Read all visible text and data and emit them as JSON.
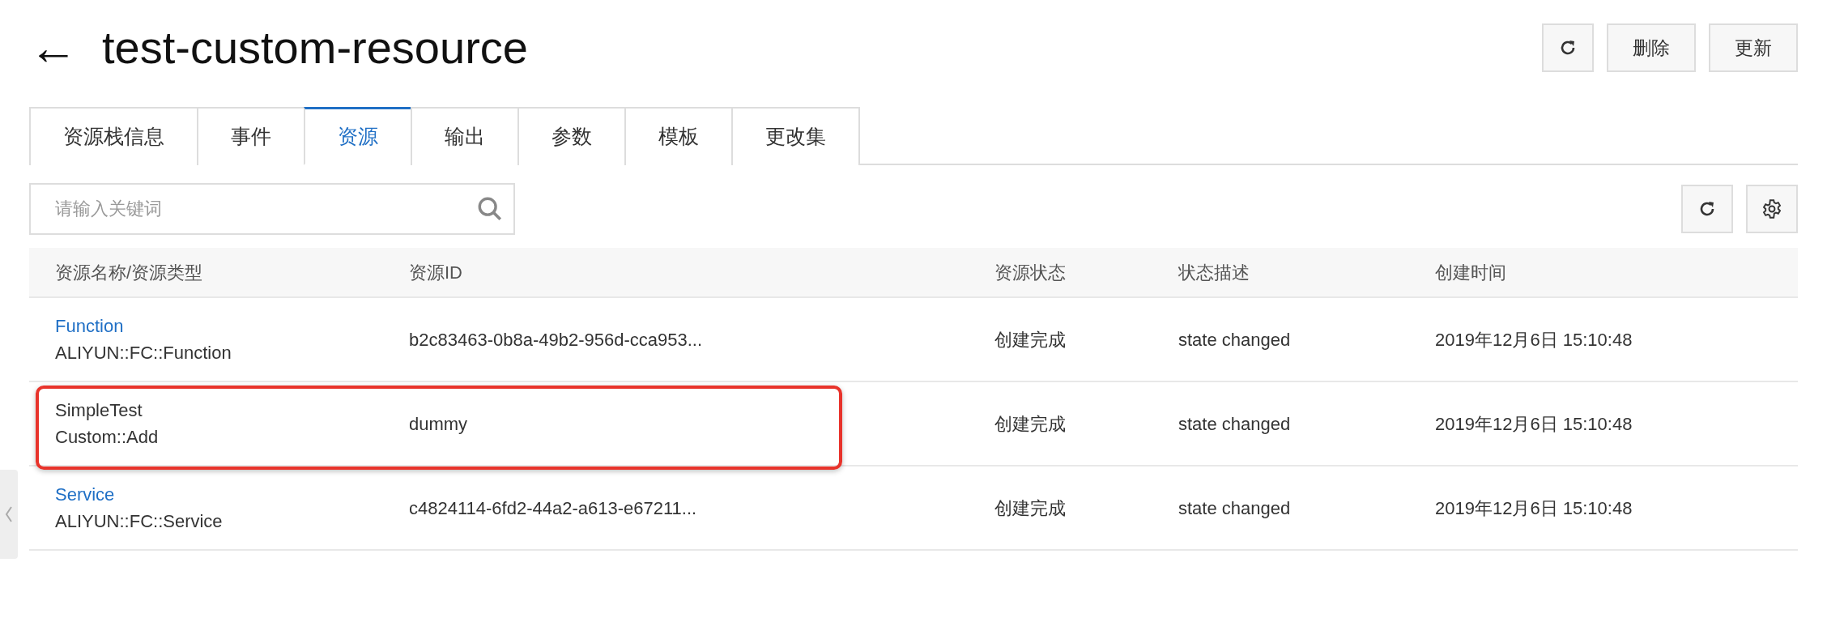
{
  "header": {
    "back": "←",
    "title": "test-custom-resource",
    "buttons": [
      {
        "kind": "refresh"
      },
      {
        "kind": "text",
        "label": "删除"
      },
      {
        "kind": "text",
        "label": "更新"
      }
    ]
  },
  "tabs": [
    {
      "label": "资源栈信息",
      "selected": false
    },
    {
      "label": "事件",
      "selected": false
    },
    {
      "label": "资源",
      "selected": true
    },
    {
      "label": "输出",
      "selected": false
    },
    {
      "label": "参数",
      "selected": false
    },
    {
      "label": "模板",
      "selected": false
    },
    {
      "label": "更改集",
      "selected": false
    }
  ],
  "search": {
    "placeholder": "请输入关键词"
  },
  "toolbar": [
    {
      "kind": "refresh"
    },
    {
      "kind": "settings"
    }
  ],
  "table": {
    "columns": [
      "资源名称/资源类型",
      "资源ID",
      "资源状态",
      "状态描述",
      "创建时间"
    ],
    "rows": [
      {
        "name": "Function",
        "link": true,
        "type": "ALIYUN::FC::Function",
        "id": "b2c83463-0b8a-49b2-956d-cca953...",
        "status": "创建完成",
        "description": "state changed",
        "created": "2019年12月6日 15:10:48",
        "highlighted": false
      },
      {
        "name": "SimpleTest",
        "link": false,
        "type": "Custom::Add",
        "id": "dummy",
        "status": "创建完成",
        "description": "state changed",
        "created": "2019年12月6日 15:10:48",
        "highlighted": true
      },
      {
        "name": "Service",
        "link": true,
        "type": "ALIYUN::FC::Service",
        "id": "c4824114-6fd2-44a2-a613-e67211...",
        "status": "创建完成",
        "description": "state changed",
        "created": "2019年12月6日 15:10:48",
        "highlighted": false
      }
    ]
  }
}
